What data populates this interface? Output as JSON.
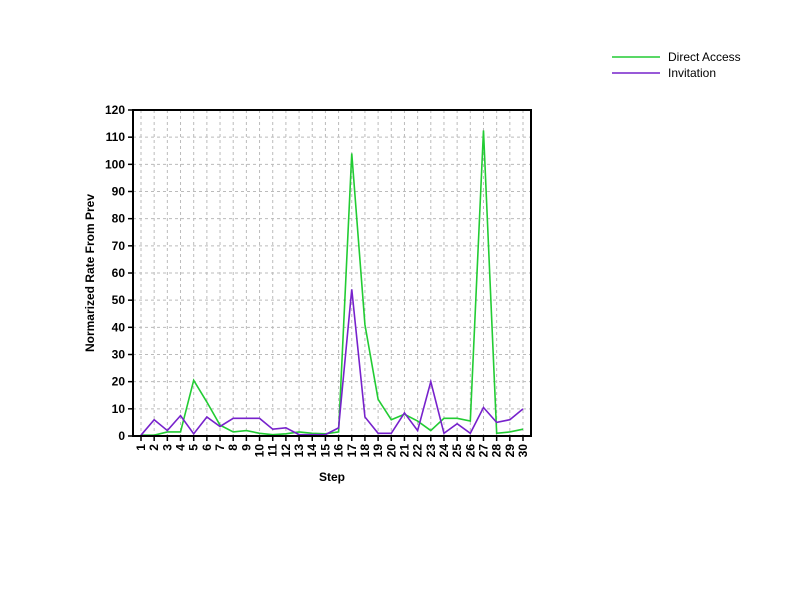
{
  "chart_data": {
    "type": "line",
    "xlabel": "Step",
    "ylabel": "Normarized Rate From Prev",
    "ylim": [
      0,
      120
    ],
    "yticks": [
      0,
      10,
      20,
      30,
      40,
      50,
      60,
      70,
      80,
      90,
      100,
      110,
      120
    ],
    "grid": true,
    "legend_position": "top-right",
    "categories": [
      "1",
      "2",
      "3",
      "4",
      "5",
      "6",
      "7",
      "8",
      "9",
      "10",
      "11",
      "12",
      "13",
      "14",
      "15",
      "16",
      "17",
      "18",
      "19",
      "20",
      "21",
      "22",
      "23",
      "24",
      "25",
      "26",
      "27",
      "28",
      "29",
      "30"
    ],
    "series": [
      {
        "name": "Direct Access",
        "color": "#22cc33",
        "values": [
          0.3,
          0.3,
          1.5,
          1.5,
          20.5,
          12.5,
          4,
          1.5,
          2,
          1,
          0.5,
          0.8,
          1.5,
          1,
          0.8,
          1.5,
          104,
          41,
          13.5,
          6,
          8,
          5.5,
          2,
          6.5,
          6.5,
          5.5,
          112.5,
          1,
          1.5,
          2.5
        ]
      },
      {
        "name": "Invitation",
        "color": "#7722cc",
        "values": [
          0.3,
          6,
          2,
          7.5,
          0.8,
          7,
          3.5,
          6.5,
          6.5,
          6.5,
          2.5,
          3,
          0.5,
          0.5,
          0.5,
          3,
          54,
          7,
          1,
          1,
          8.5,
          2,
          20,
          1,
          4.5,
          1,
          10.5,
          5,
          6,
          10
        ]
      }
    ]
  }
}
